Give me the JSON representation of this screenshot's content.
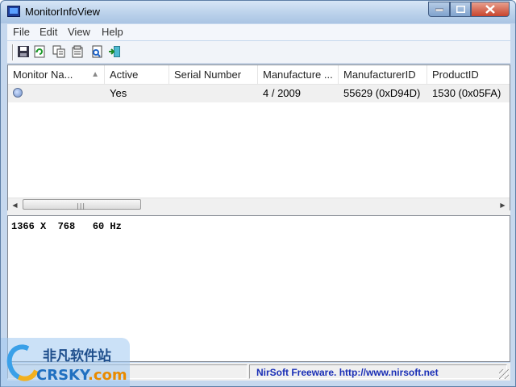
{
  "window": {
    "title": "MonitorInfoView"
  },
  "menu": [
    "File",
    "Edit",
    "View",
    "Help"
  ],
  "toolbar": {
    "buttons": [
      "save-icon",
      "refresh-icon",
      "copy-icon",
      "properties-icon",
      "find-icon",
      "exit-icon"
    ]
  },
  "table": {
    "columns": [
      "Monitor Na...",
      "Active",
      "Serial Number",
      "Manufacture ...",
      "ManufacturerID",
      "ProductID"
    ],
    "rows": [
      {
        "monitor_name": "",
        "active": "Yes",
        "serial_number": "",
        "manufacture": "4 / 2009",
        "manufacturer_id": "55629 (0xD94D)",
        "product_id": "1530 (0x05FA)"
      }
    ]
  },
  "info_text": "1366 X  768   60 Hz",
  "status": {
    "link_text": "NirSoft Freeware.  http://www.nirsoft.net"
  },
  "watermark": {
    "cn": "非凡软件站",
    "en": "CRSKY",
    "suffix": ".com"
  },
  "colors": {
    "accent": "#1a2fb6",
    "title_bg": "#c6d8ee",
    "close": "#c8442d"
  }
}
